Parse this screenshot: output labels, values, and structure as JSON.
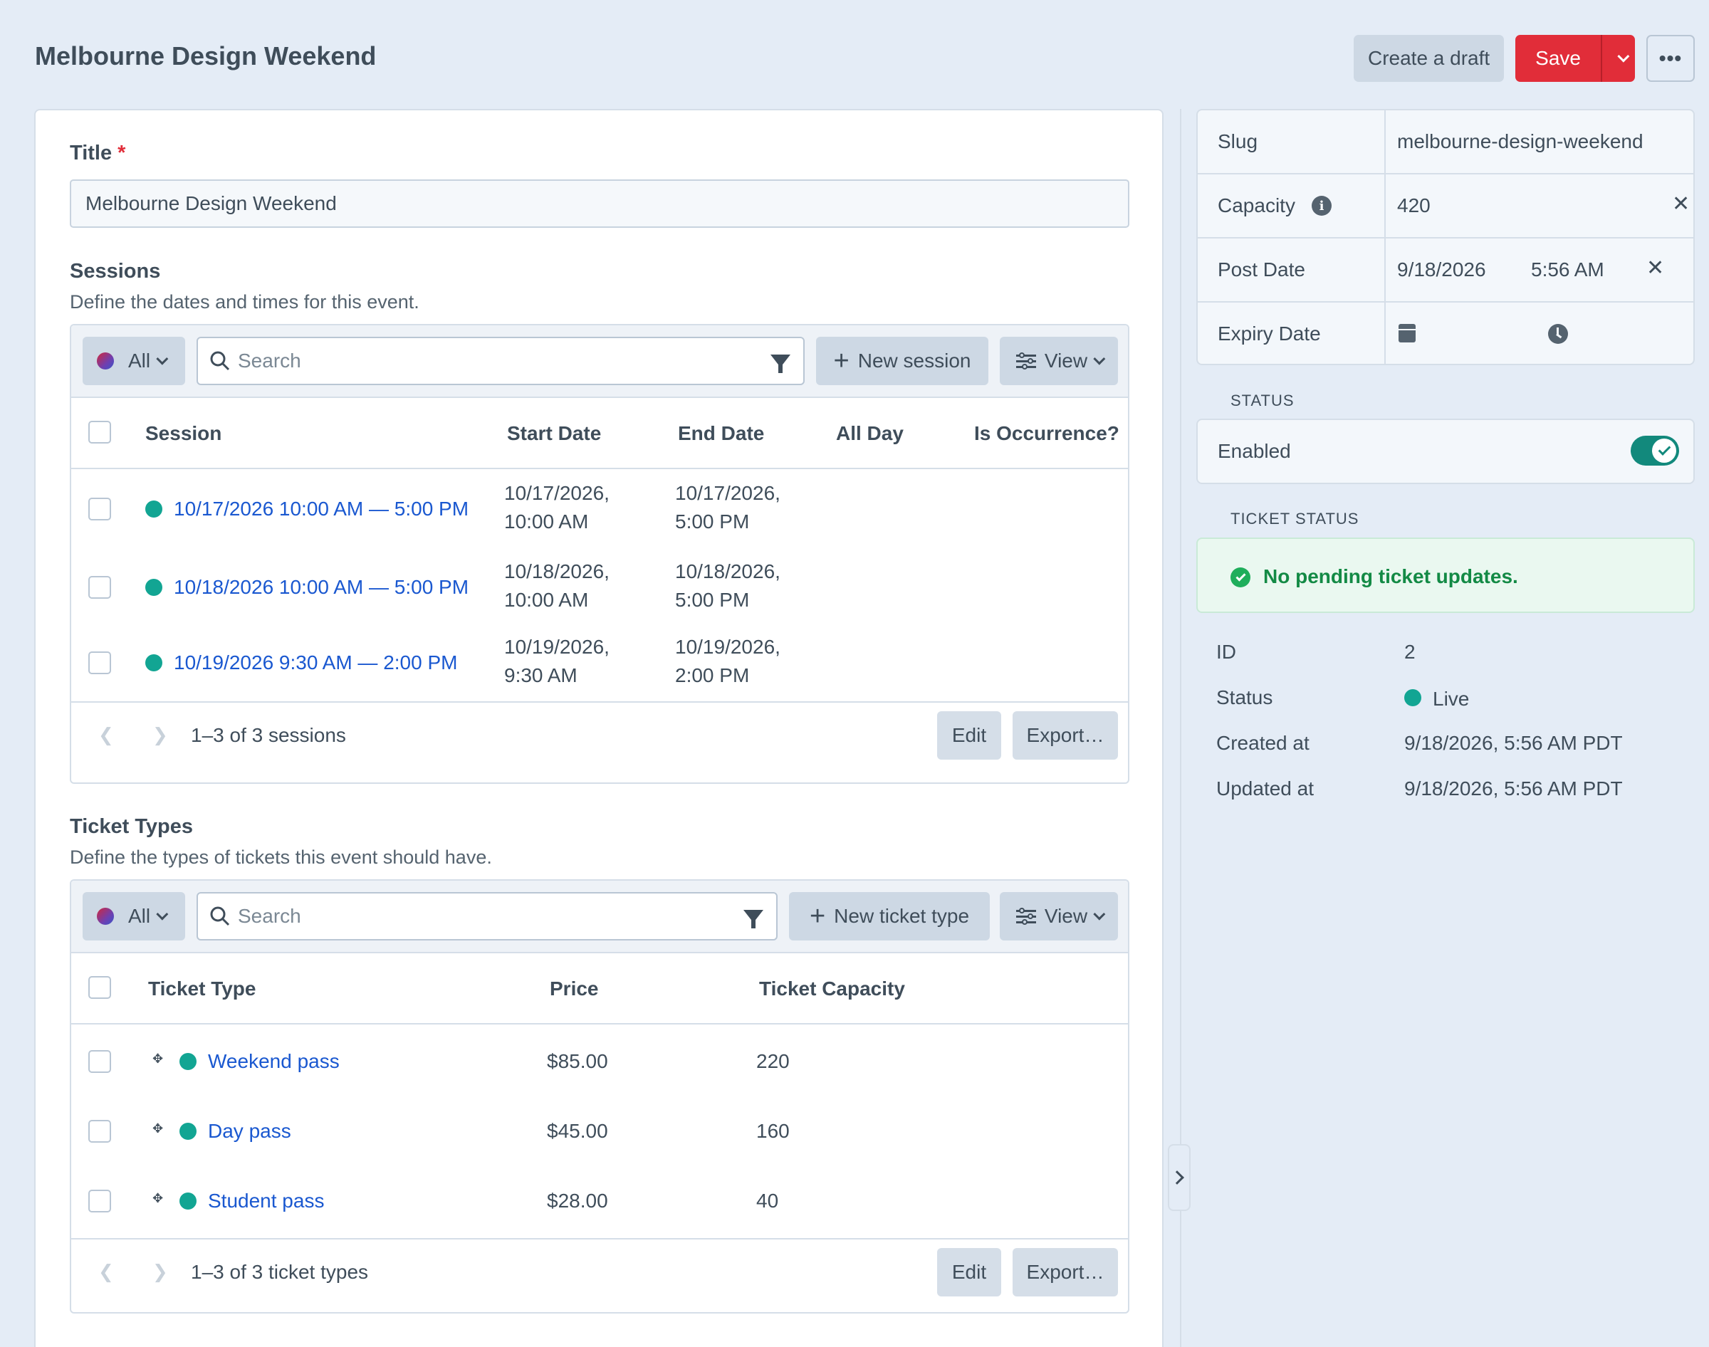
{
  "header": {
    "title": "Melbourne Design Weekend",
    "create_draft": "Create a draft",
    "save": "Save",
    "more": "•••"
  },
  "form": {
    "title_label": "Title",
    "required_mark": "*",
    "title_value": "Melbourne Design Weekend"
  },
  "sessions": {
    "heading": "Sessions",
    "description": "Define the dates and times for this event.",
    "toolbar": {
      "site": "All",
      "search_placeholder": "Search",
      "new_label": "New session",
      "view_label": "View"
    },
    "columns": [
      "Session",
      "Start Date",
      "End Date",
      "All Day",
      "Is Occurrence?"
    ],
    "rows": [
      {
        "title": "10/17/2026 10:00 AM — 5:00 PM",
        "start_1": "10/17/2026,",
        "start_2": "10:00 AM",
        "end_1": "10/17/2026,",
        "end_2": "5:00 PM"
      },
      {
        "title": "10/18/2026 10:00 AM — 5:00 PM",
        "start_1": "10/18/2026,",
        "start_2": "10:00 AM",
        "end_1": "10/18/2026,",
        "end_2": "5:00 PM"
      },
      {
        "title": "10/19/2026 9:30 AM — 2:00 PM",
        "start_1": "10/19/2026,",
        "start_2": "9:30 AM",
        "end_1": "10/19/2026,",
        "end_2": "2:00 PM"
      }
    ],
    "pagination": "1–3 of 3 sessions",
    "edit_label": "Edit",
    "export_label": "Export…"
  },
  "ticket_types": {
    "heading": "Ticket Types",
    "description": "Define the types of tickets this event should have.",
    "toolbar": {
      "site": "All",
      "search_placeholder": "Search",
      "new_label": "New ticket type",
      "view_label": "View"
    },
    "columns": [
      "Ticket Type",
      "Price",
      "Ticket Capacity"
    ],
    "rows": [
      {
        "title": "Weekend pass",
        "price": "$85.00",
        "capacity": "220"
      },
      {
        "title": "Day pass",
        "price": "$45.00",
        "capacity": "160"
      },
      {
        "title": "Student pass",
        "price": "$28.00",
        "capacity": "40"
      }
    ],
    "pagination": "1–3 of 3 ticket types",
    "edit_label": "Edit",
    "export_label": "Export…"
  },
  "sidebar": {
    "slug_label": "Slug",
    "slug_value": "melbourne-design-weekend",
    "capacity_label": "Capacity",
    "capacity_value": "420",
    "post_date_label": "Post Date",
    "post_date_value": "9/18/2026",
    "post_time_value": "5:56 AM",
    "expiry_date_label": "Expiry Date",
    "status_heading": "STATUS",
    "enabled_label": "Enabled",
    "enabled": true,
    "ticket_status_heading": "TICKET STATUS",
    "ticket_status_message": "No pending ticket updates.",
    "info": {
      "id_label": "ID",
      "id_value": "2",
      "status_label": "Status",
      "status_value": "Live",
      "created_label": "Created at",
      "created_value": "9/18/2026, 5:56 AM PDT",
      "updated_label": "Updated at",
      "updated_value": "9/18/2026, 5:56 AM PDT"
    }
  },
  "colors": {
    "accent_red": "#e12d39",
    "link_blue": "#1a58d0",
    "status_teal": "#12a593",
    "success_green": "#138a45"
  }
}
